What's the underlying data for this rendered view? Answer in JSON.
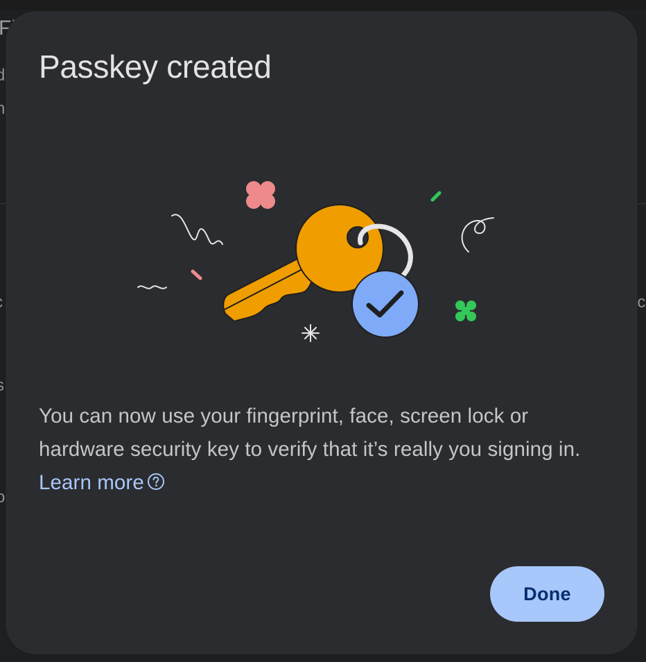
{
  "background_fragments": [
    "Fi",
    "d",
    "n",
    "c",
    "s",
    "o",
    "lc"
  ],
  "dialog": {
    "title": "Passkey created",
    "body_text": "You can now use your fingerprint, face, screen lock or hardware security key to verify that it’s really you signing in. ",
    "learn_more_label": "Learn more",
    "learn_more_icon": "help-circle-icon",
    "done_label": "Done"
  },
  "illustration": {
    "subject": "key-with-checkmark-illustration",
    "colors": {
      "key": "#f09d00",
      "check_badge": "#7faaf7",
      "pink": "#ee8a8b",
      "green": "#34c759",
      "ring": "#e6e6e6"
    }
  },
  "colors": {
    "dialog_bg": "#2b2c2f",
    "title": "#e3e3e3",
    "body": "#c4c7c5",
    "link": "#a8c7fa",
    "button_bg": "#a8c7fa",
    "button_text": "#062e6f"
  }
}
